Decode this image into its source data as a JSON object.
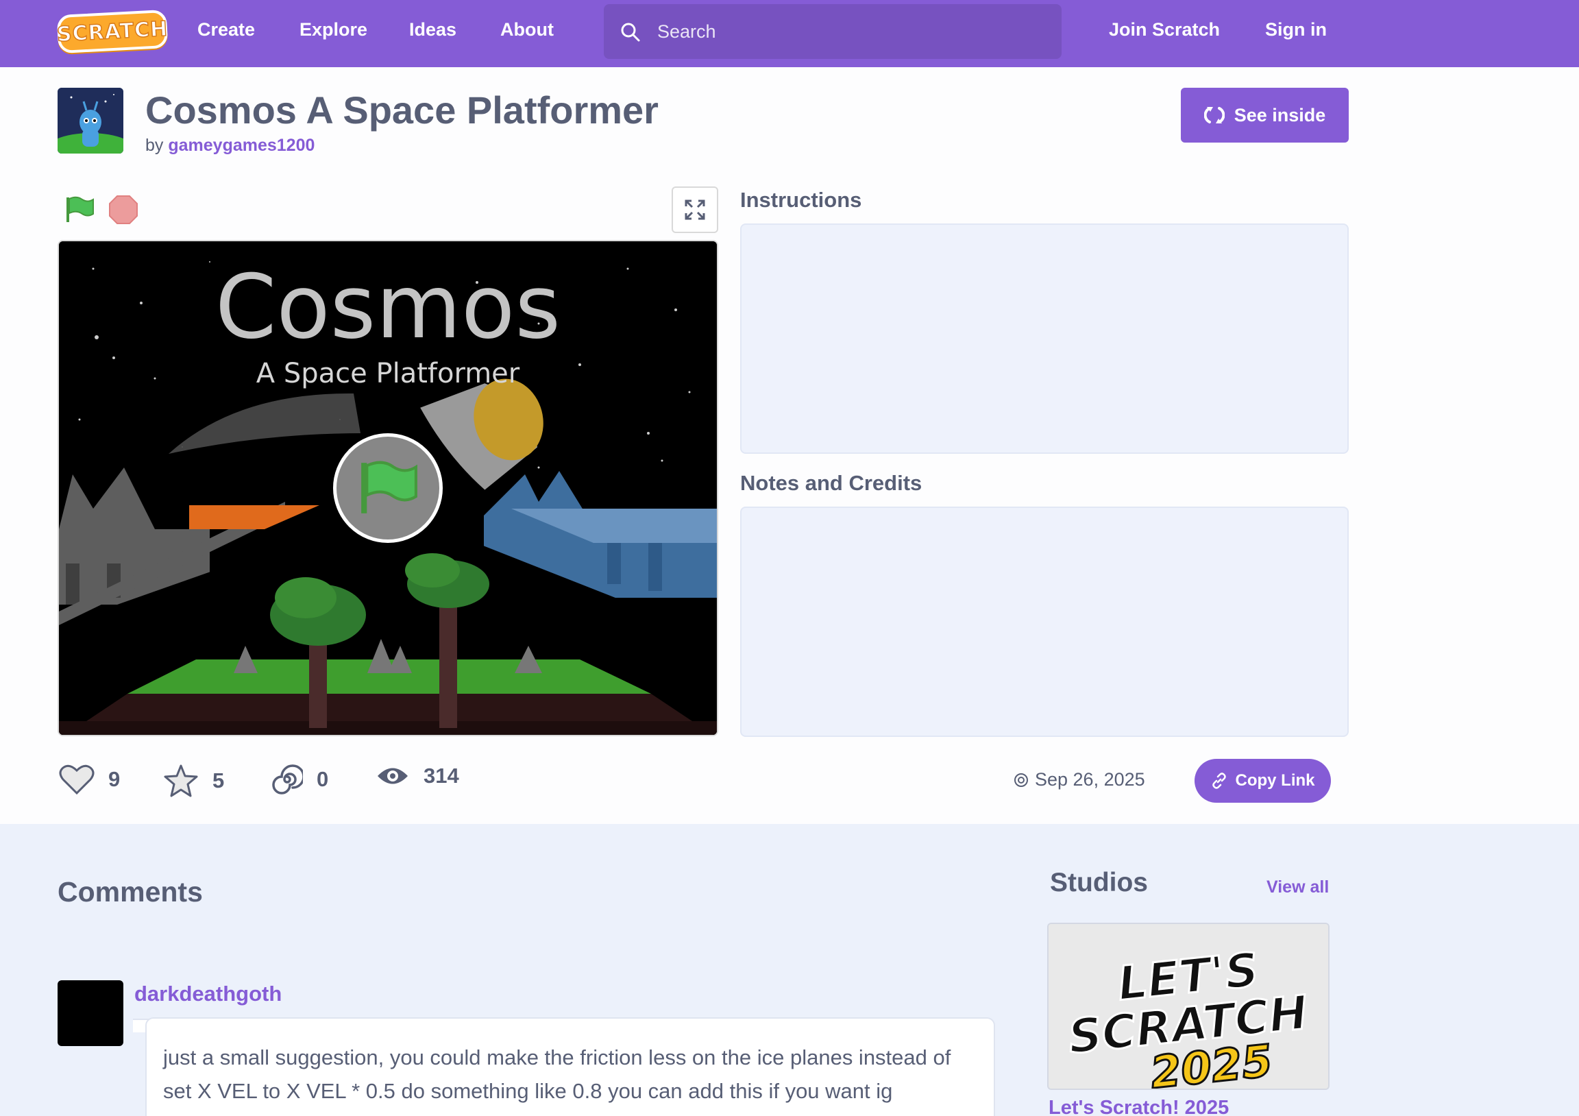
{
  "nav": {
    "logo": "SCRATCH",
    "links": [
      "Create",
      "Explore",
      "Ideas",
      "About"
    ],
    "search_placeholder": "Search",
    "join": "Join Scratch",
    "sign_in": "Sign in"
  },
  "project": {
    "title": "Cosmos A Space Platformer",
    "by": "by",
    "author": "gameygames1200",
    "see_inside": "See inside",
    "stage_title": "Cosmos",
    "stage_subtitle": "A Space Platformer"
  },
  "sections": {
    "instructions": "Instructions",
    "notes": "Notes and Credits"
  },
  "stats": {
    "loves": "9",
    "favorites": "5",
    "remixes": "0",
    "views": "314",
    "date": "Sep 26, 2025",
    "copy_link": "Copy Link"
  },
  "comments": {
    "title": "Comments",
    "items": [
      {
        "user": "darkdeathgoth",
        "text": "just a small suggestion, you could make the friction less on the ice planes instead of set X VEL to X VEL * 0.5 do something like 0.8 you can add this if you want ig"
      }
    ]
  },
  "studios": {
    "title": "Studios",
    "view_all": "View all",
    "items": [
      {
        "name": "Let's Scratch! 2025",
        "card_text_1": "LET'S",
        "card_text_2": "SCRATCH",
        "card_text_3": "2025"
      }
    ]
  },
  "colors": {
    "brand": "#855cd6",
    "text": "#575e75",
    "panel": "#eef2fc"
  }
}
